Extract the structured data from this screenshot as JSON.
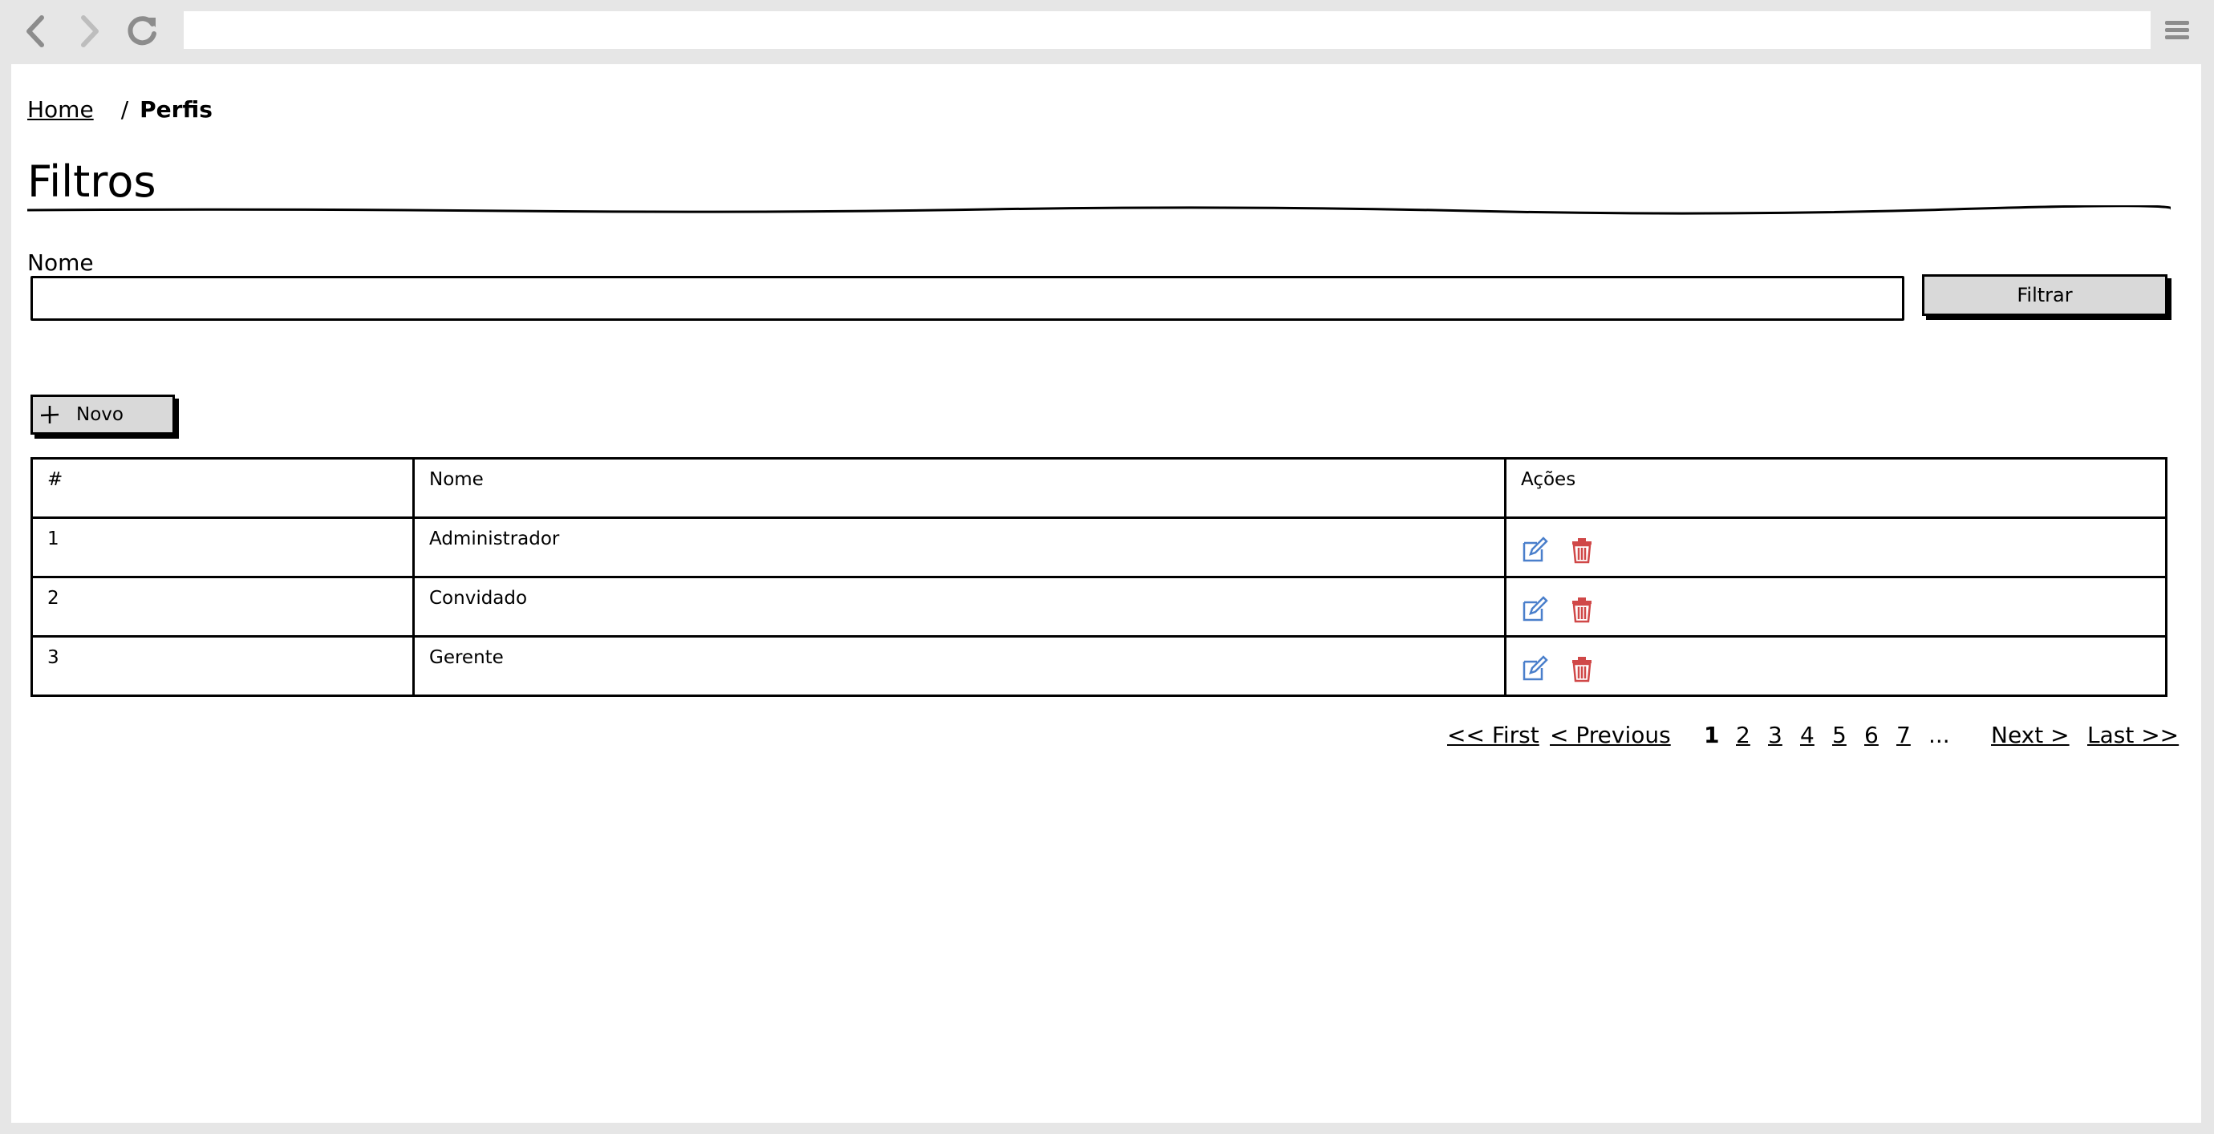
{
  "browser": {
    "url": ""
  },
  "breadcrumb": {
    "home": "Home",
    "separator": "/",
    "current": "Perfis"
  },
  "filters": {
    "title": "Filtros",
    "name_label": "Nome",
    "name_value": "",
    "filter_button": "Filtrar"
  },
  "actions": {
    "new_button": "Novo"
  },
  "table": {
    "headers": [
      "#",
      "Nome",
      "Ações"
    ],
    "rows": [
      {
        "id": "1",
        "nome": "Administrador"
      },
      {
        "id": "2",
        "nome": "Convidado"
      },
      {
        "id": "3",
        "nome": "Gerente"
      }
    ]
  },
  "pagination": {
    "first": "<< First",
    "previous": "< Previous",
    "pages": [
      "1",
      "2",
      "3",
      "4",
      "5",
      "6",
      "7"
    ],
    "ellipsis": "...",
    "next": "Next >",
    "last": "Last >>",
    "current_page": "1"
  },
  "icons": {
    "back": "chevron-left-icon",
    "forward": "chevron-right-icon",
    "reload": "reload-icon",
    "menu": "hamburger-menu-icon",
    "add": "plus-icon",
    "edit": "edit-icon",
    "delete": "trash-icon"
  },
  "colors": {
    "edit_icon": "#4a7fcb",
    "delete_icon": "#d04848",
    "button_fill": "#d9d9d9",
    "chrome": "#e6e6e6"
  }
}
